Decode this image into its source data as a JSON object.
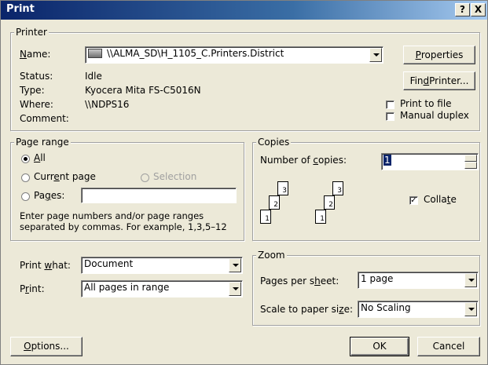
{
  "window": {
    "title": "Print",
    "help_label": "?",
    "close_label": "X"
  },
  "printer": {
    "group_label": "Printer",
    "name_label": "Name:",
    "name_value": "\\\\ALMA_SD\\H_1105_C.Printers.District",
    "properties_label": "Properties",
    "status_label": "Status:",
    "status_value": "Idle",
    "type_label": "Type:",
    "type_value": "Kyocera Mita FS-C5016N",
    "where_label": "Where:",
    "where_value": "\\\\NDPS16",
    "comment_label": "Comment:",
    "find_printer_label": "Find Printer...",
    "print_to_file_label": "Print to file",
    "manual_duplex_label": "Manual duplex"
  },
  "page_range": {
    "group_label": "Page range",
    "all_label": "All",
    "current_page_label": "Current page",
    "selection_label": "Selection",
    "pages_label": "Pages:",
    "pages_value": "",
    "help_line1": "Enter page numbers and/or page ranges",
    "help_line2": "separated by commas.  For example, 1,3,5–12"
  },
  "copies": {
    "group_label": "Copies",
    "number_label": "Number of copies:",
    "number_value": "1",
    "collate_label": "Collate",
    "collate_checked": true
  },
  "print_what": {
    "label": "Print what:",
    "value": "Document"
  },
  "print": {
    "label": "Print:",
    "value": "All pages in range"
  },
  "zoom": {
    "group_label": "Zoom",
    "pages_per_sheet_label": "Pages per sheet:",
    "pages_per_sheet_value": "1 page",
    "scale_label": "Scale to paper size:",
    "scale_value": "No Scaling"
  },
  "buttons": {
    "options": "Options...",
    "ok": "OK",
    "cancel": "Cancel"
  }
}
